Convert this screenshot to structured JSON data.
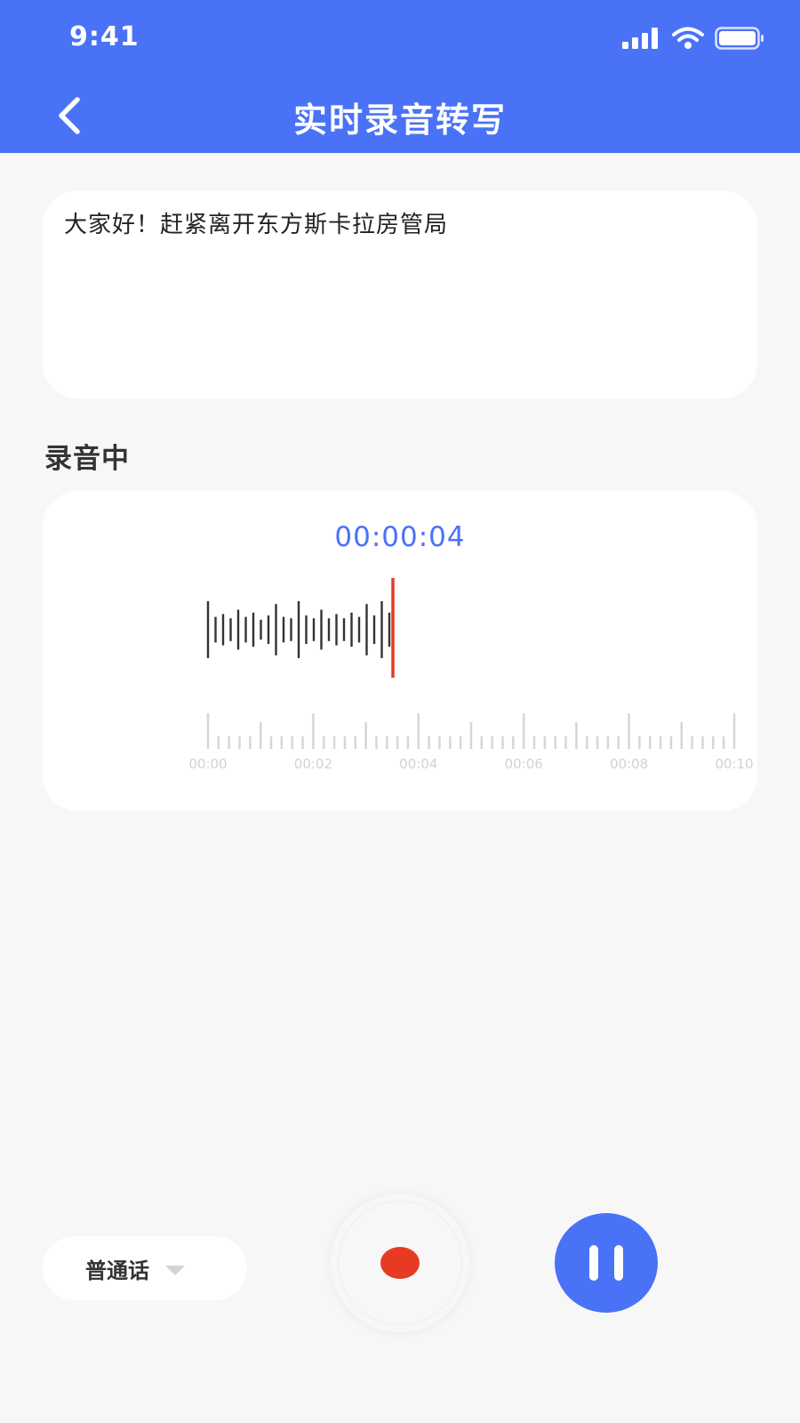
{
  "status_bar": {
    "time": "9:41"
  },
  "header": {
    "title": "实时录音转写"
  },
  "transcript": {
    "text": "大家好！赶紧离开东方斯卡拉房管局"
  },
  "recording": {
    "section_label": "录音中",
    "timer": "00:00:04",
    "timeline_labels": [
      "00:00",
      "00:02",
      "00:04",
      "00:06",
      "00:08",
      "00:10"
    ],
    "waveform_levels": [
      1,
      0.45,
      0.55,
      0.4,
      0.7,
      0.45,
      0.6,
      0.35,
      0.5,
      0.9,
      0.45,
      0.4,
      1,
      0.5,
      0.4,
      0.7,
      0.4,
      0.55,
      0.4,
      0.6,
      0.45,
      0.9,
      0.5,
      1,
      0.6
    ],
    "playhead_color": "#e63b22"
  },
  "controls": {
    "dialect": "普通话",
    "record_icon": "record-dot-icon",
    "pause_icon": "pause-icon"
  },
  "colors": {
    "accent": "#4a72f6",
    "record": "#e63b22",
    "background": "#f7f7f7"
  }
}
